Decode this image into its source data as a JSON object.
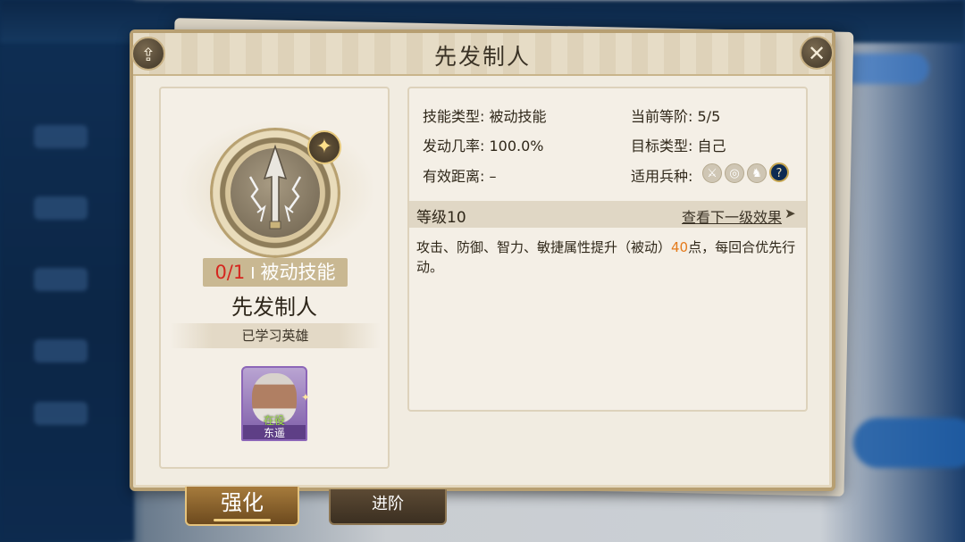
{
  "title": "先发制人",
  "skill": {
    "count": "0/1",
    "separator": "I",
    "type_label": "被动技能",
    "name": "先发制人",
    "learned_label": "已学习英雄"
  },
  "hero": {
    "tag": "在役",
    "name": "东遥"
  },
  "info": {
    "skill_type_key": "技能类型:",
    "skill_type_val": "被动技能",
    "rank_key": "当前等阶:",
    "rank_val": "5/5",
    "rate_key": "发动几率:",
    "rate_val": "100.0%",
    "target_key": "目标类型:",
    "target_val": "自己",
    "range_key": "有效距离:",
    "range_val": "–",
    "troop_key": "适用兵种:"
  },
  "troop_icons": [
    "sword-icon",
    "bow-target-icon",
    "horse-icon",
    "question-icon"
  ],
  "level": {
    "label": "等级10",
    "next_link": "查看下一级效果",
    "arrow": "➤"
  },
  "description": {
    "part1": "攻击、防御、智力、敏捷属性提升（被动）",
    "number": "40",
    "part2": "点，每回合优先行动。"
  },
  "tabs": {
    "strengthen": "强化",
    "advance": "进阶"
  },
  "colors": {
    "count_red": "#d5261f",
    "number_orange": "#e47a1b",
    "hero_tag_green": "#9cdc4c"
  }
}
